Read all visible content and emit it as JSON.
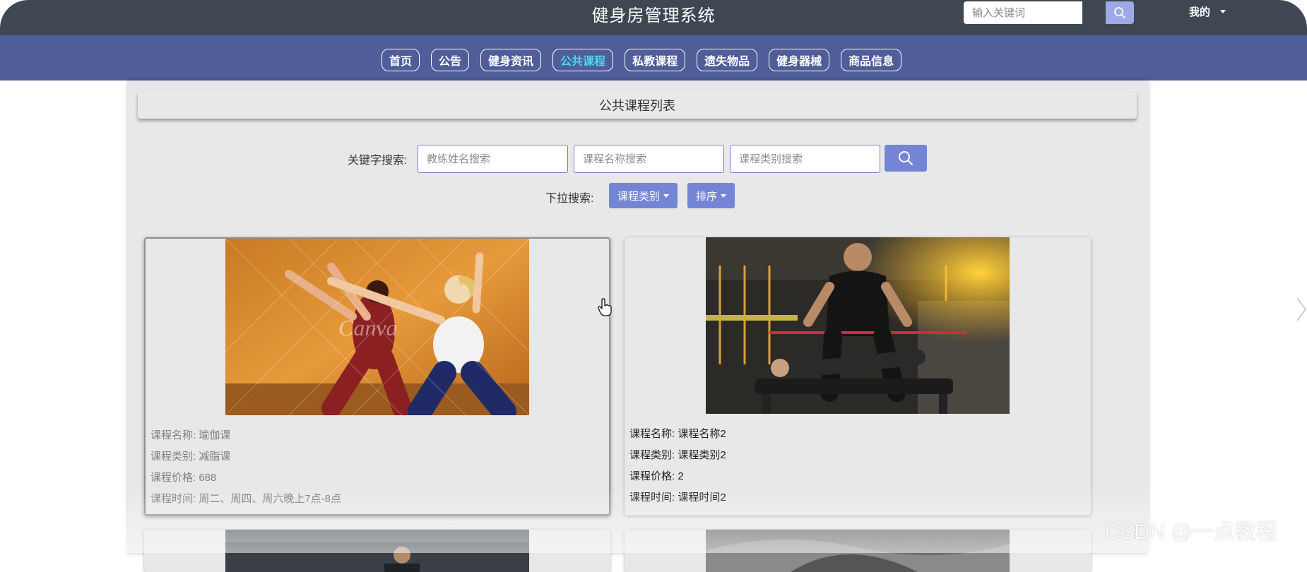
{
  "header": {
    "title": "健身房管理系统",
    "search_placeholder": "输入关键词",
    "user_menu": "我的"
  },
  "nav": {
    "items": [
      "首页",
      "公告",
      "健身资讯",
      "公共课程",
      "私教课程",
      "遗失物品",
      "健身器械",
      "商品信息"
    ],
    "active": "公共课程"
  },
  "page": {
    "list_title": "公共课程列表",
    "keyword_label": "关键字搜索:",
    "placeholders": {
      "coach": "教练姓名搜索",
      "course_name": "课程名称搜索",
      "course_type": "课程类别搜索"
    },
    "dropdown_label": "下拉搜索:",
    "dropdowns": [
      "课程类别",
      "排序"
    ]
  },
  "courses": [
    {
      "name_label": "课程名称: 瑜伽课",
      "type_label": "课程类别: 减脂课",
      "price_label": "课程价格: 688",
      "time_label": "课程时间: 周二、周四、周六晚上7点-8点",
      "image_overlay": "Canva"
    },
    {
      "name_label": "课程名称: 课程名称2",
      "type_label": "课程类别: 课程类别2",
      "price_label": "课程价格: 2",
      "time_label": "课程时间: 课程时间2"
    }
  ],
  "watermark": "CSDN @一点教程",
  "colors": {
    "topbar": "#3e4752",
    "navbar": "#4f5d99",
    "accent": "#7585d6",
    "active_nav": "#4fd6f2"
  }
}
